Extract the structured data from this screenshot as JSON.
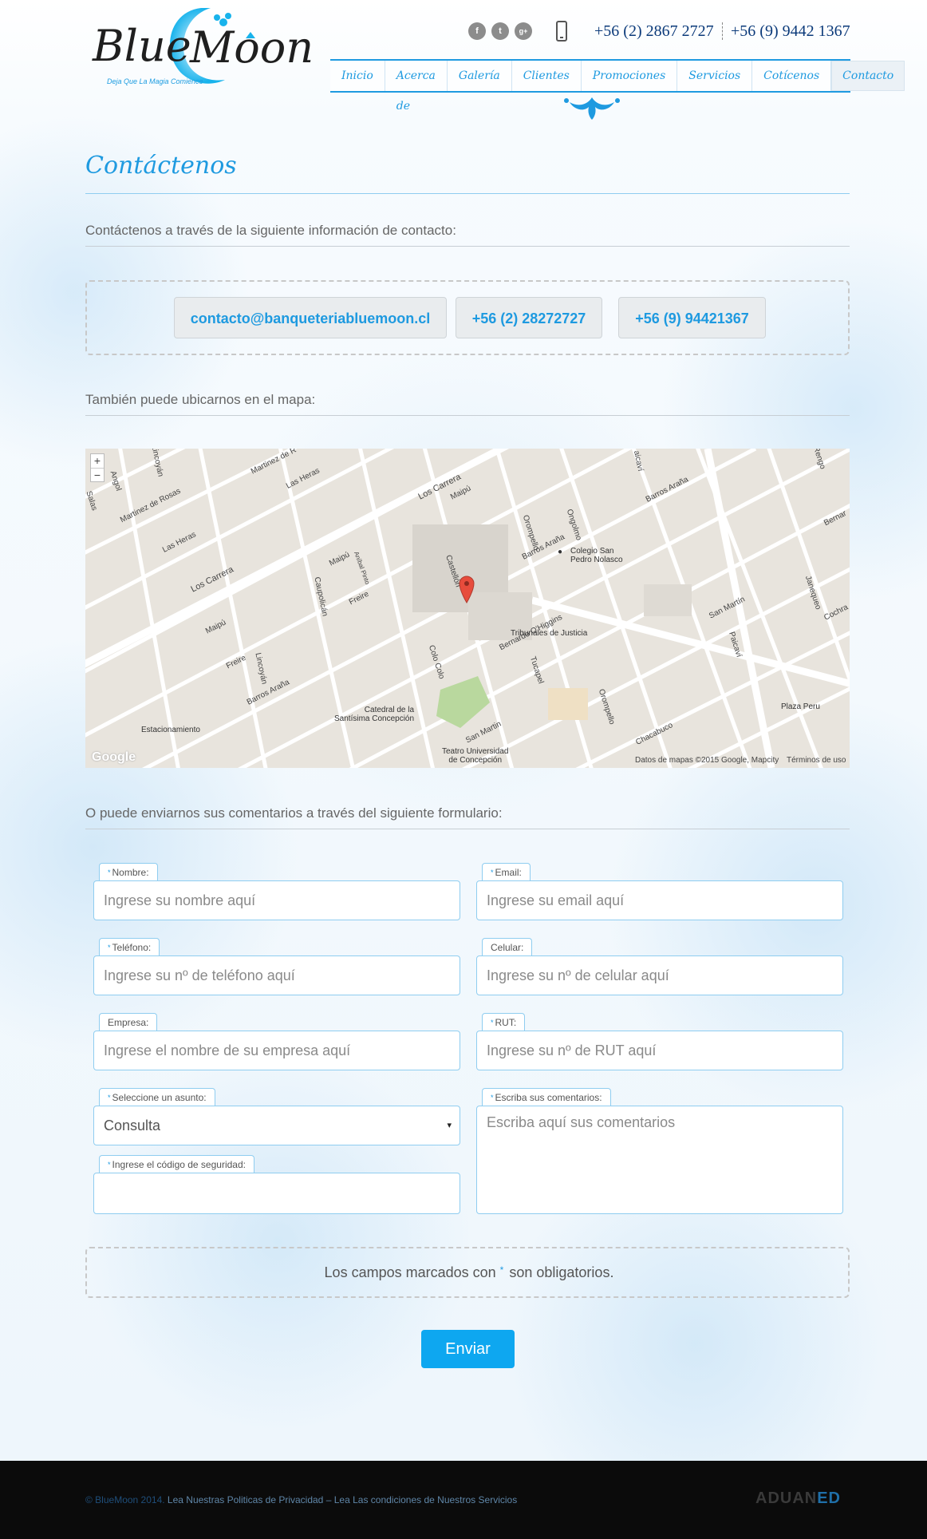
{
  "header": {
    "logo": {
      "wordmark_line1": "Blue",
      "wordmark_line2": "Moon",
      "tagline": "Deja Que La Magia Comience"
    },
    "social": [
      {
        "icon": "facebook-icon",
        "glyph": "f"
      },
      {
        "icon": "twitter-icon",
        "glyph": "t"
      },
      {
        "icon": "google-plus-icon",
        "glyph": "g+"
      }
    ],
    "phone1": "+56 (2) 2867 2727",
    "phone2": "+56 (9) 9442 1367",
    "nav": [
      "Inicio",
      "Acerca de",
      "Galería",
      "Clientes",
      "Promociones",
      "Servicios",
      "Cotícenos",
      "Contacto"
    ],
    "active_nav": "Contacto"
  },
  "page": {
    "title": "Contáctenos",
    "intro": "Contáctenos a través de la siguiente información de contacto:",
    "email": "contacto@banqueteriabluemoon.cl",
    "phone_a": "+56 (2) 28272727",
    "phone_b": "+56 (9) 94421367",
    "map_intro": "También puede ubicarnos en el mapa:",
    "form_intro": "O puede enviarnos sus comentarios a través del siguiente formulario:"
  },
  "map": {
    "zoom_in": "+",
    "zoom_out": "−",
    "streets": {
      "los_carrera_1": "Los Carrera",
      "los_carrera_2": "Los Carrera",
      "martinez_rosas_1": "Martinez de Rosas",
      "martinez_rosas_2": "Martinez de R",
      "las_heras_1": "Las Heras",
      "las_heras_2": "Las Heras",
      "maipu_1": "Maipú",
      "maipu_2": "Maipú",
      "maipu_3": "Maipú",
      "freire_1": "Freire",
      "freire_2": "Freire",
      "barros_arana_1": "Barros Araña",
      "barros_arana_2": "Barros Araña",
      "barros_arana_3": "Barros Araña",
      "caupolican": "Caupolicán",
      "lincoyan_1": "Lincoyán",
      "lincoyan_2": "Lincoyán",
      "anibal_pinto": "Aníbal Pinto",
      "castellon": "Castellón",
      "colo_colo": "Colo Colo",
      "orompello_1": "Orompello",
      "orompello_2": "Orompello",
      "ongolmo": "Ongolmo",
      "bernardo_ohiggins": "Bernardo O'Higgins",
      "tucapel": "Tucapel",
      "san_martin_1": "San Martin",
      "san_martin_2": "San Martín",
      "paicavi_1": "Paicaví",
      "paicavi_2": "aicaví",
      "chacabuco": "Chacabuco",
      "janequeo": "Janequeo",
      "angol": "Angol",
      "salas": "Salas",
      "rengo": "Rengo",
      "cochrane": "Cochra",
      "berna": "Bernar"
    },
    "places": {
      "colegio": "Colegio San Pedro Nolasco",
      "colegio_l1": "Colegio San",
      "colegio_l2": "Pedro Nolasco",
      "tribunales": "Tribunales de Justicia",
      "catedral_l1": "Catedral de la",
      "catedral_l2": "Santísima Concepción",
      "teatro_l1": "Teatro Universidad",
      "teatro_l2": "de Concepción",
      "estacionamiento": "Estacionamiento",
      "plaza_peru": "Plaza Peru"
    },
    "attribution": "Datos de mapas ©2015 Google, Mapcity",
    "terms": "Términos de uso",
    "google": "Google"
  },
  "form": {
    "nombre": {
      "label": "Nombre:",
      "placeholder": "Ingrese su nombre aquí",
      "required": "*"
    },
    "email": {
      "label": "Email:",
      "placeholder": "Ingrese su email aquí",
      "required": "*"
    },
    "telefono": {
      "label": "Teléfono:",
      "placeholder": "Ingrese su nº de teléfono aquí",
      "required": "*"
    },
    "celular": {
      "label": "Celular:",
      "placeholder": "Ingrese su nº de celular aquí"
    },
    "empresa": {
      "label": "Empresa:",
      "placeholder": "Ingrese el nombre de su empresa aquí"
    },
    "rut": {
      "label": "RUT:",
      "placeholder": "Ingrese su nº de RUT aquí",
      "required": "*"
    },
    "asunto": {
      "label": "Seleccione un asunto:",
      "value": "Consulta",
      "required": "*",
      "caret": "▾"
    },
    "comentarios": {
      "label": "Escriba sus comentarios:",
      "placeholder": "Escriba aquí sus comentarios",
      "required": "*"
    },
    "codigo": {
      "label": "Ingrese el código de seguridad:",
      "required": "*"
    },
    "note_before": "Los campos marcados con",
    "note_star": "*",
    "note_after": "son obligatorios.",
    "submit": "Enviar"
  },
  "footer": {
    "copyright": "© BlueMoon 2014.",
    "privacy": "Lea Nuestras Politicas de Privacidad",
    "separator": "–",
    "terms": "Lea Las condiciones de Nuestros Servicios",
    "brand_prefix": "ADUAN",
    "brand_suffix": "ED"
  },
  "colors": {
    "accent": "#1e9ae0",
    "button": "#0ea7f0",
    "footer": "#0b0b0b",
    "map_bg": "#e8e4dd"
  }
}
